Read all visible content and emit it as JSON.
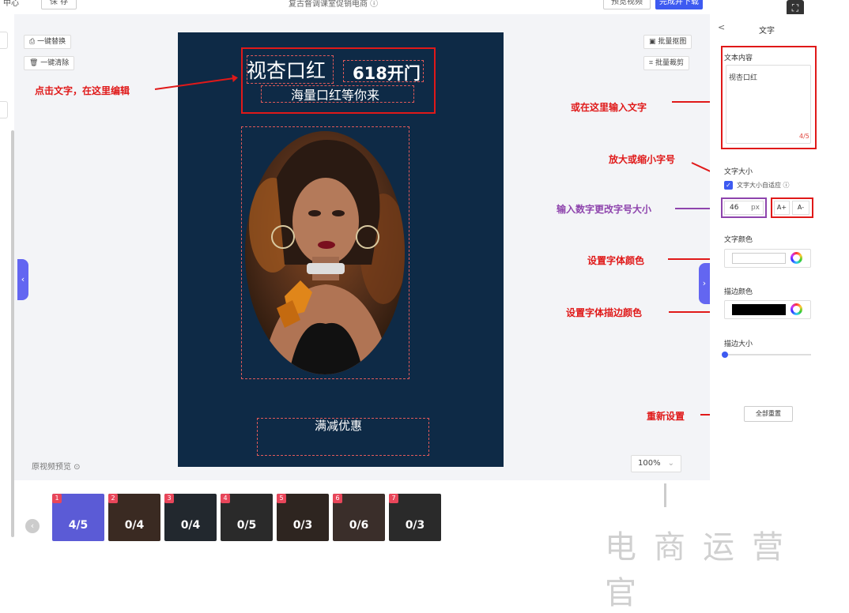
{
  "topbar": {
    "left_text": "中心",
    "save_label": "保 存",
    "title": "复古督调课室促销电商 ⓘ",
    "preview_label": "预览视频",
    "finish_label": "完成并下载"
  },
  "toolbar": {
    "replace_label": "一键替换",
    "clear_label": "一键清除",
    "batch_crop_label": "批量抠图",
    "batch_cut_label": "批量裁剪"
  },
  "canvas": {
    "title_text": "视杏口红",
    "badge_text": "618开门",
    "subtitle_text": "海量口红等你来",
    "bottom_text": "满减优惠",
    "bg_color": "#0e2a46"
  },
  "preview_label": "原视频预览 ⊙",
  "zoom": "100%",
  "annotations": {
    "edit_text": "点击文字，在这里编辑",
    "input_here": "或在这里输入文字",
    "size_buttons": "放大或缩小字号",
    "size_input": "输入数字更改字号大小",
    "font_color": "设置字体颜色",
    "stroke_color": "设置字体描边颜色",
    "reset": "重新设置"
  },
  "panel": {
    "back": "<",
    "title": "文字",
    "text_content_label": "文本内容",
    "text_value": "视杏口红",
    "char_count": "4/5",
    "font_size_label": "文字大小",
    "auto_fit_label": "文字大小自适应 ⓘ",
    "font_size_value": "46",
    "px": "px",
    "a_plus": "A+",
    "a_minus": "A-",
    "color_label": "文字颜色",
    "stroke_label": "描边颜色",
    "stroke_size_label": "描边大小",
    "reset_all": "全部重置",
    "stroke_swatch": "#000000",
    "text_swatch": "#ffffff"
  },
  "thumbnails": [
    {
      "num": "1",
      "val": "4/5"
    },
    {
      "num": "2",
      "val": "0/4"
    },
    {
      "num": "3",
      "val": "0/4"
    },
    {
      "num": "4",
      "val": "0/5"
    },
    {
      "num": "5",
      "val": "0/3"
    },
    {
      "num": "6",
      "val": "0/6"
    },
    {
      "num": "7",
      "val": "0/3"
    }
  ],
  "watermark": "电商运营官",
  "colors": {
    "accent": "#3d5af1",
    "annotation": "#e01919",
    "purple": "#8e44ad"
  }
}
